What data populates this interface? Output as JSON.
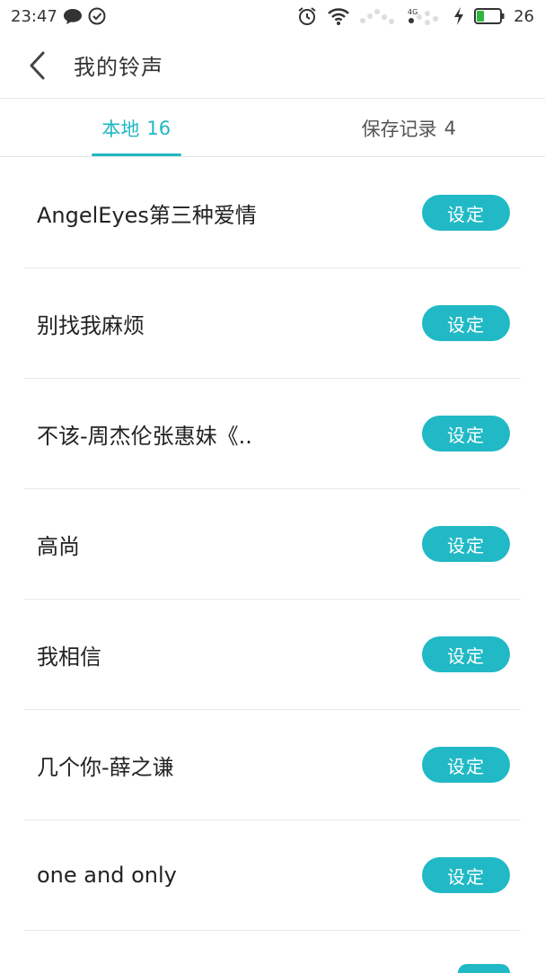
{
  "status_bar": {
    "time": "23:47",
    "battery_level": "26",
    "icons": [
      "message-icon",
      "check-circle-icon",
      "alarm-icon",
      "wifi-icon",
      "signal-4g-icon",
      "charging-icon",
      "battery-icon"
    ]
  },
  "app_bar": {
    "title": "我的铃声"
  },
  "tabs": [
    {
      "label": "本地",
      "count": "16",
      "active": true
    },
    {
      "label": "保存记录",
      "count": "4",
      "active": false
    }
  ],
  "ringtones": [
    {
      "title": "AngelEyes第三种爱情",
      "action": "设定"
    },
    {
      "title": "别找我麻烦",
      "action": "设定"
    },
    {
      "title": "不该-周杰伦张惠妹《..",
      "action": "设定"
    },
    {
      "title": "高尚",
      "action": "设定"
    },
    {
      "title": "我相信",
      "action": "设定"
    },
    {
      "title": "几个你-薛之谦",
      "action": "设定"
    },
    {
      "title": "one and only",
      "action": "设定"
    }
  ],
  "colors": {
    "accent": "#20b9c5",
    "divider": "#e8e8e8",
    "text": "#222222"
  }
}
